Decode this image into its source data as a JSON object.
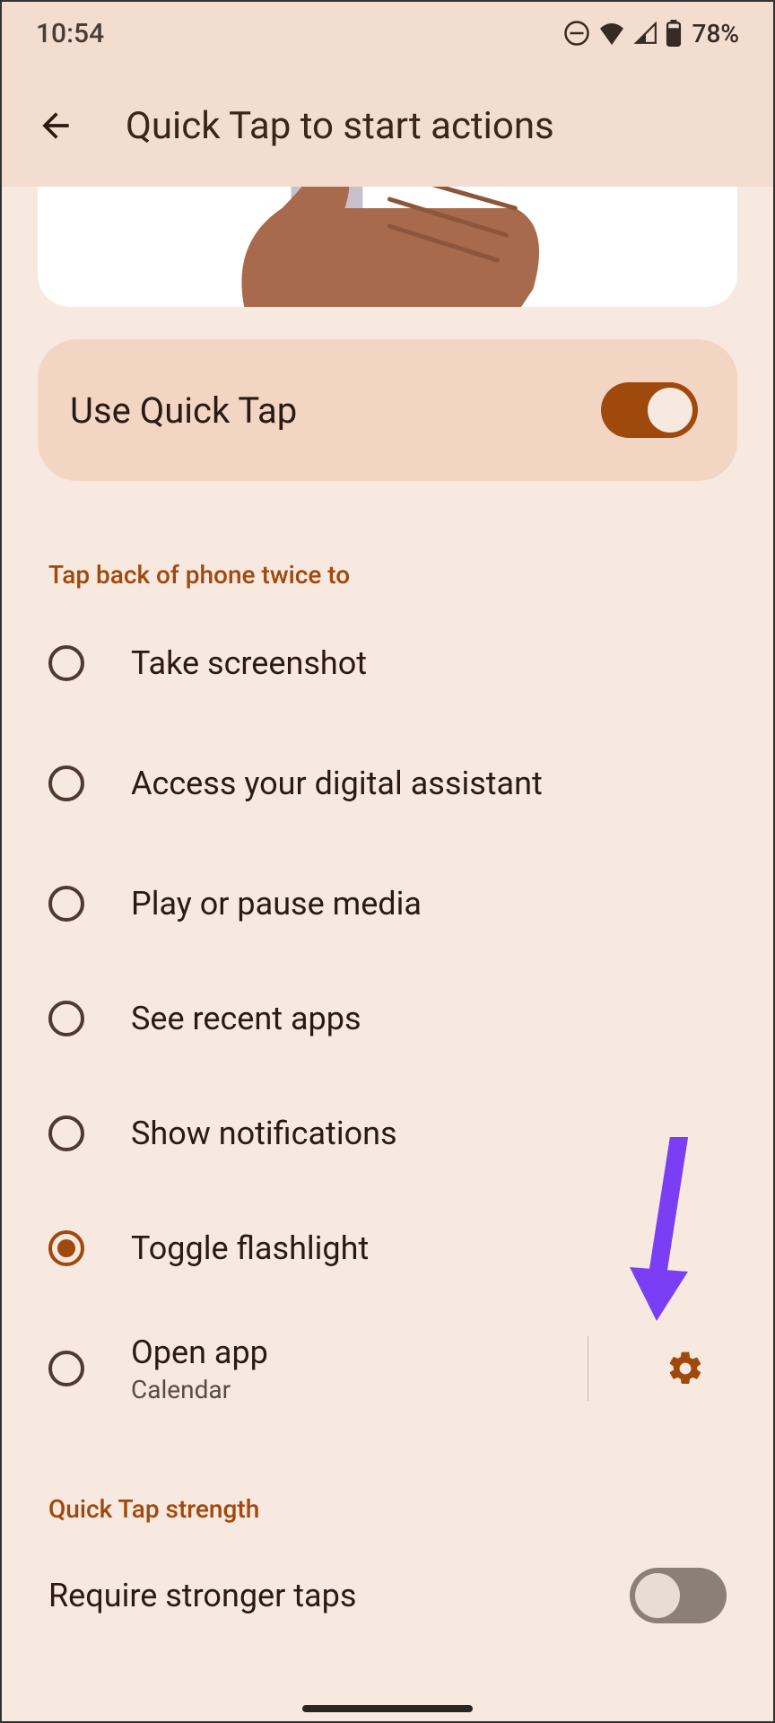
{
  "status": {
    "time": "10:54",
    "battery_pct": "78%"
  },
  "header": {
    "title": "Quick Tap to start actions"
  },
  "main_toggle": {
    "label": "Use Quick Tap",
    "enabled": true
  },
  "actions_section": {
    "header": "Tap back of phone twice to",
    "options": [
      {
        "label": "Take screenshot",
        "selected": false
      },
      {
        "label": "Access your digital assistant",
        "selected": false
      },
      {
        "label": "Play or pause media",
        "selected": false
      },
      {
        "label": "See recent apps",
        "selected": false
      },
      {
        "label": "Show notifications",
        "selected": false
      },
      {
        "label": "Toggle flashlight",
        "selected": true
      },
      {
        "label": "Open app",
        "sub": "Calendar",
        "selected": false,
        "has_settings": true
      }
    ]
  },
  "strength_section": {
    "header": "Quick Tap strength",
    "setting_label": "Require stronger taps",
    "setting_enabled": false
  },
  "annotation": {
    "type": "arrow",
    "color": "#7a3ef5",
    "points_to": "open-app-settings-gear"
  }
}
